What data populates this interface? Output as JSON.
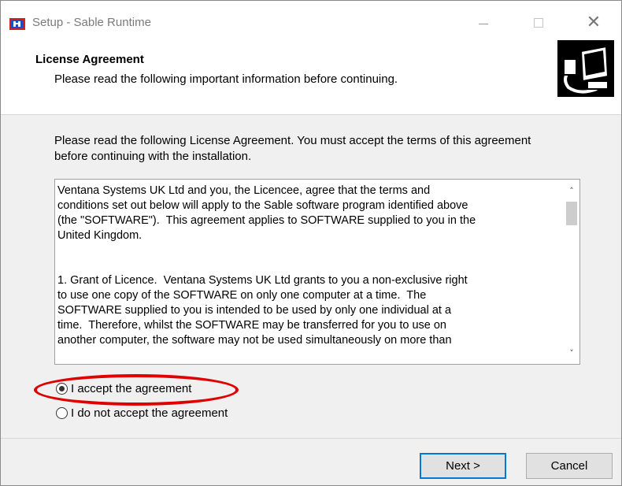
{
  "window": {
    "title": "Setup - Sable Runtime",
    "controls": {
      "minimize": "—",
      "maximize": "☐",
      "close": "✕"
    }
  },
  "header": {
    "title": "License Agreement",
    "subtitle": "Please read the following important information before continuing."
  },
  "body": {
    "intro": "Please read the following License Agreement. You must accept the terms of this agreement before continuing with the installation.",
    "license_text": "Ventana Systems UK Ltd and you, the Licencee, agree that the terms and\nconditions set out below will apply to the Sable software program identified above\n(the \"SOFTWARE\").  This agreement applies to SOFTWARE supplied to you in the\nUnited Kingdom.\n\n\n1. Grant of Licence.  Ventana Systems UK Ltd grants to you a non-exclusive right\nto use one copy of the SOFTWARE on only one computer at a time.  The\nSOFTWARE supplied to you is intended to be used by only one individual at a\ntime.  Therefore, whilst the SOFTWARE may be transferred for you to use on\nanother computer, the software may not be used simultaneously on more than",
    "scroll_up": "˄",
    "scroll_down": "˅"
  },
  "options": {
    "accept_label": "I accept the agreement",
    "decline_label": "I do not accept the agreement",
    "selected": "accept"
  },
  "buttons": {
    "next": "Next >",
    "cancel": "Cancel"
  },
  "colors": {
    "highlight": "#e00000",
    "default_button_border": "#0078d7"
  }
}
